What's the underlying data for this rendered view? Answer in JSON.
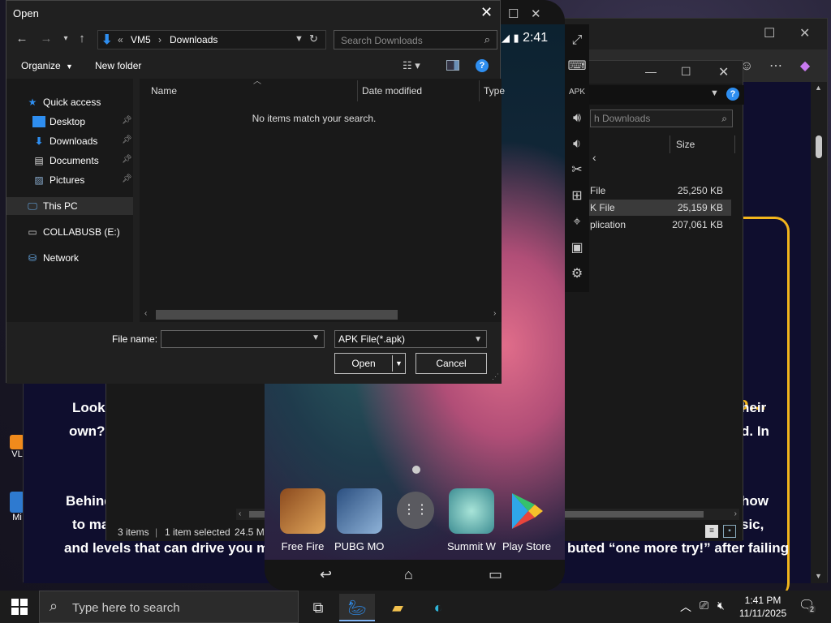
{
  "dialog": {
    "title": "Open",
    "address": {
      "root": "VM5",
      "folder": "Downloads",
      "prefix": "«"
    },
    "search_placeholder": "Search Downloads",
    "organize": "Organize",
    "new_folder": "New folder",
    "nav": [
      {
        "label": "Quick access",
        "icon": "star-icon",
        "pinned": false
      },
      {
        "label": "Desktop",
        "icon": "desktop-icon",
        "pinned": true
      },
      {
        "label": "Downloads",
        "icon": "download-arrow-icon",
        "pinned": true
      },
      {
        "label": "Documents",
        "icon": "document-icon",
        "pinned": true
      },
      {
        "label": "Pictures",
        "icon": "pictures-icon",
        "pinned": true
      },
      {
        "label": "This PC",
        "icon": "pc-icon",
        "pinned": false
      },
      {
        "label": "COLLABUSB (E:)",
        "icon": "usb-drive-icon",
        "pinned": false
      },
      {
        "label": "Network",
        "icon": "network-icon",
        "pinned": false
      }
    ],
    "columns": {
      "name": "Name",
      "date": "Date modified",
      "type": "Type"
    },
    "empty_message": "No items match your search.",
    "file_name_label": "File name:",
    "file_name_value": "",
    "file_type": "APK File(*.apk)",
    "open_button": "Open",
    "cancel_button": "Cancel"
  },
  "explorer2": {
    "search_placeholder": "h Downloads",
    "size_header": "Size",
    "rows": [
      {
        "type": "File",
        "size": "25,250 KB",
        "selected": false
      },
      {
        "type": "K File",
        "size": "25,159 KB",
        "selected": true
      },
      {
        "type": "plication",
        "size": "207,061 KB",
        "selected": false
      }
    ],
    "status_items": "3 items",
    "status_selected": "1 item selected",
    "status_size": "24.5 ME"
  },
  "emulator": {
    "time": "2:41",
    "apps": [
      {
        "label": "Free Fire",
        "color": "#b8742e"
      },
      {
        "label": "PUBG MOI",
        "color": "#3e6fae"
      },
      {
        "label": "",
        "color": "#5a5a60"
      },
      {
        "label": "Summit W",
        "color": "#6ab9b5"
      },
      {
        "label": "Play Store",
        "color": "#1e1e1e"
      }
    ]
  },
  "article": {
    "lines": [
      {
        "left": "Looki",
        "right": "heir"
      },
      {
        "left": "own?",
        "right": "d. In"
      },
      {
        "left": "Behind",
        "right": "how"
      },
      {
        "left": "to ma",
        "right": "sic,"
      },
      {
        "left": "and levels that can drive you ma",
        "right": "buted “one more try!” after failing"
      }
    ],
    "ellipsis": "o…"
  },
  "desktop_icons": [
    {
      "label": "VL"
    },
    {
      "label": "Mi"
    }
  ],
  "taskbar": {
    "search_placeholder": "Type here to search",
    "time": "1:41 PM",
    "date": "11/11/2025",
    "notification_count": "2"
  },
  "colors": {
    "accent": "#f2b51c",
    "selection": "#2e2e2e",
    "link_blue": "#2e8ef0"
  }
}
